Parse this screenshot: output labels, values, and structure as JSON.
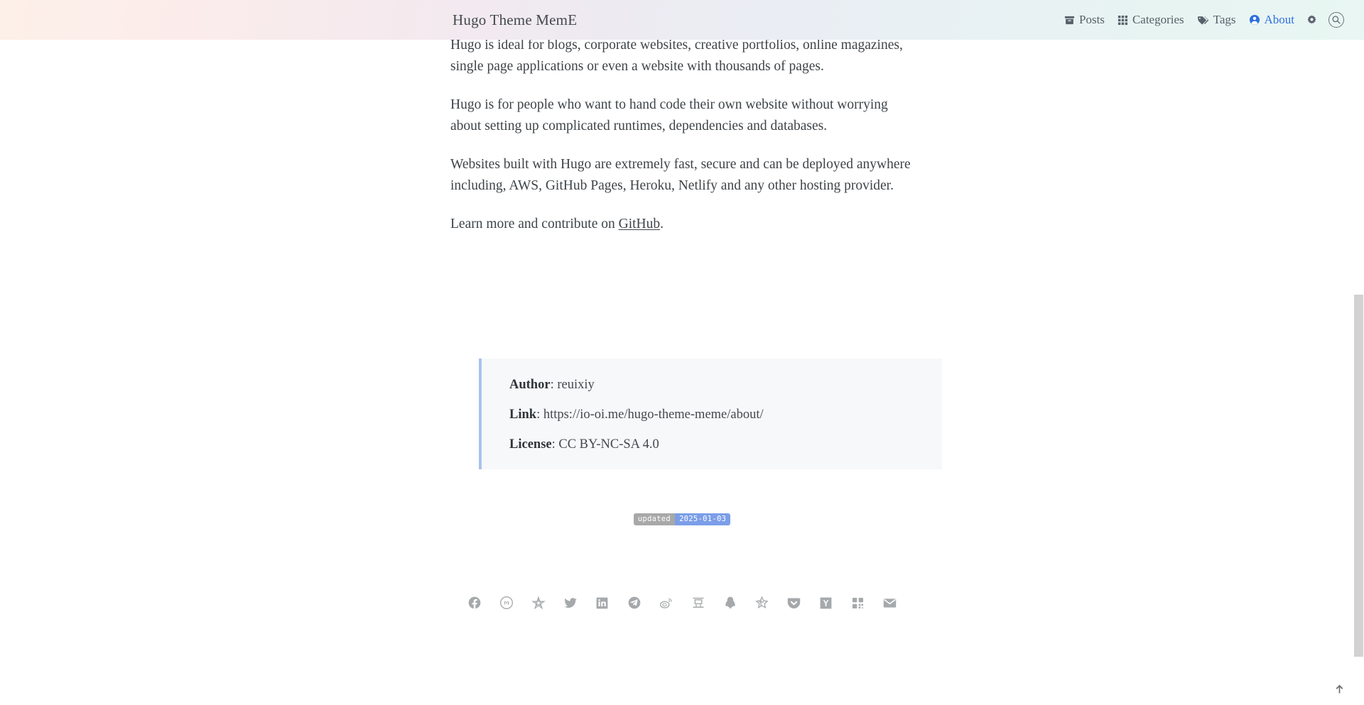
{
  "header": {
    "site_title": "Hugo Theme MemE",
    "nav": [
      {
        "label": "Posts",
        "icon": "archive-icon",
        "active": false
      },
      {
        "label": "Categories",
        "icon": "grid-icon",
        "active": false
      },
      {
        "label": "Tags",
        "icon": "tag-icon",
        "active": false
      },
      {
        "label": "About",
        "icon": "user-circle-icon",
        "active": true
      }
    ],
    "settings_icon": "gear-icon",
    "search_icon": "search-icon",
    "gradient_start": "#fdf0e8",
    "gradient_end": "#e9f6f3",
    "active_color": "#2f6fe0"
  },
  "post": {
    "paragraphs": [
      "Hugo is ideal for blogs, corporate websites, creative portfolios, online magazines, single page applications or even a website with thousands of pages.",
      "Hugo is for people who want to hand code their own website without worrying about setting up complicated runtimes, dependencies and databases.",
      "Websites built with Hugo are extremely fast, secure and can be deployed anywhere including, AWS, GitHub Pages, Heroku, Netlify and any other hosting provider."
    ],
    "last_paragraph_prefix": "Learn more and contribute on ",
    "last_paragraph_link": "GitHub",
    "last_paragraph_suffix": "."
  },
  "copyright": {
    "author_key": "Author",
    "author_sep": ": ",
    "author_value": "reuixiy",
    "link_key": "Link",
    "link_sep": ": ",
    "link_value": "https://io-oi.me/hugo-theme-meme/about/",
    "license_key": "License",
    "license_sep": ": ",
    "license_value": "CC BY-NC-SA 4.0",
    "border_color": "#a7c2ef",
    "background": "#f7f8f9"
  },
  "meta": {
    "updated_label": "updated",
    "updated_value": "2025-01-03",
    "label_color": "#a8a8a8",
    "value_color": "#7b9ee8"
  },
  "footer": {
    "social": [
      {
        "name": "facebook-icon",
        "label": "Facebook"
      },
      {
        "name": "mastodon-icon",
        "label": "Mastodon"
      },
      {
        "name": "diaspora-icon",
        "label": "Diaspora"
      },
      {
        "name": "twitter-icon",
        "label": "Twitter"
      },
      {
        "name": "linkedin-icon",
        "label": "LinkedIn"
      },
      {
        "name": "telegram-icon",
        "label": "Telegram"
      },
      {
        "name": "weibo-icon",
        "label": "Weibo"
      },
      {
        "name": "douban-icon",
        "label": "Douban"
      },
      {
        "name": "qq-icon",
        "label": "QQ"
      },
      {
        "name": "zhihu-icon",
        "label": "Zhihu"
      },
      {
        "name": "pocket-icon",
        "label": "Pocket"
      },
      {
        "name": "hackernews-icon",
        "label": "Hacker News"
      },
      {
        "name": "qrcode-icon",
        "label": "QR Code"
      },
      {
        "name": "email-icon",
        "label": "Email"
      }
    ],
    "icon_color": "#a6a9ab"
  },
  "chrome": {
    "back_to_top_icon": "arrow-up-icon",
    "scrollbar_thumb_color": "#d2d2d2"
  }
}
